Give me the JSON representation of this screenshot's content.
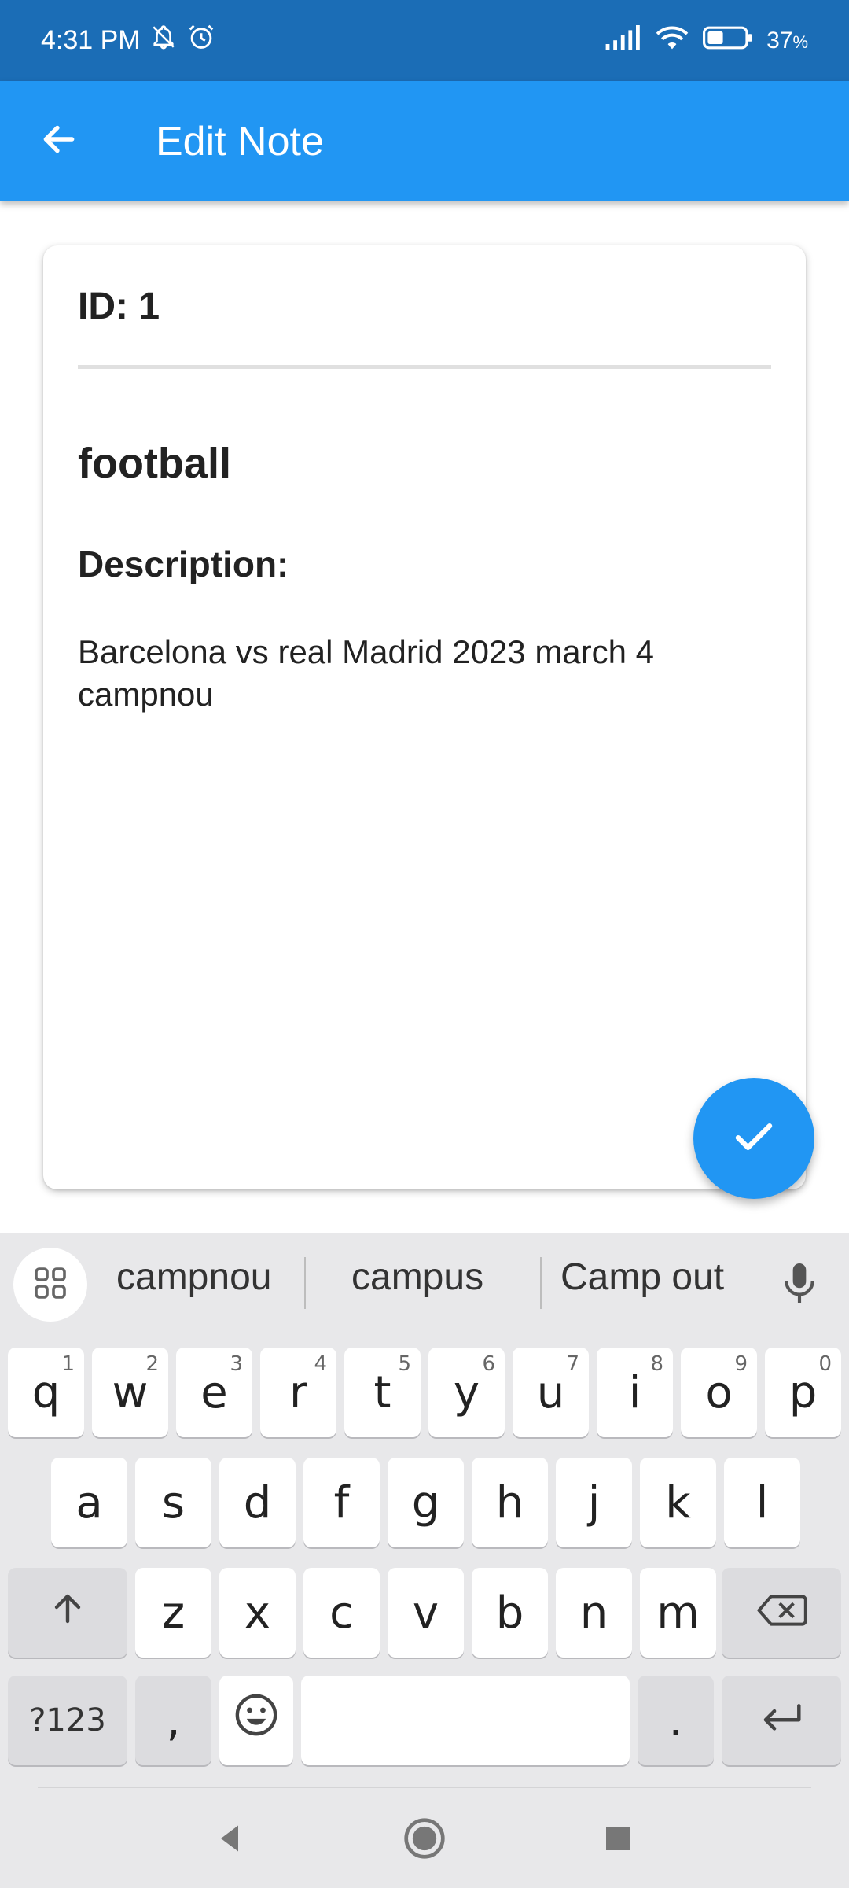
{
  "status_bar": {
    "time": "4:31 PM",
    "battery_pct": "37",
    "battery_unit": "%",
    "icons": [
      "notifications-off-icon",
      "alarm-icon",
      "signal-icon",
      "wifi-icon",
      "battery-icon"
    ]
  },
  "app_bar": {
    "title": "Edit Note",
    "back_icon": "arrow-back-icon"
  },
  "note": {
    "id_label": "ID: 1",
    "title": "football",
    "description_label": "Description:",
    "description": "Barcelona vs real Madrid 2023 march 4 campnou"
  },
  "fab": {
    "icon": "check-icon"
  },
  "keyboard": {
    "suggestions": [
      "campnou",
      "campus",
      "Camp out"
    ],
    "row1": [
      {
        "k": "q",
        "s": "1"
      },
      {
        "k": "w",
        "s": "2"
      },
      {
        "k": "e",
        "s": "3"
      },
      {
        "k": "r",
        "s": "4"
      },
      {
        "k": "t",
        "s": "5"
      },
      {
        "k": "y",
        "s": "6"
      },
      {
        "k": "u",
        "s": "7"
      },
      {
        "k": "i",
        "s": "8"
      },
      {
        "k": "o",
        "s": "9"
      },
      {
        "k": "p",
        "s": "0"
      }
    ],
    "row2": [
      "a",
      "s",
      "d",
      "f",
      "g",
      "h",
      "j",
      "k",
      "l"
    ],
    "row3": [
      "z",
      "x",
      "c",
      "v",
      "b",
      "n",
      "m"
    ],
    "symbols_label": "?123",
    "comma": ",",
    "period": "."
  },
  "colors": {
    "status_bar": "#1b6db6",
    "app_bar": "#2196f3",
    "fab": "#2196f3",
    "keyboard_bg": "#e8e8ea"
  }
}
